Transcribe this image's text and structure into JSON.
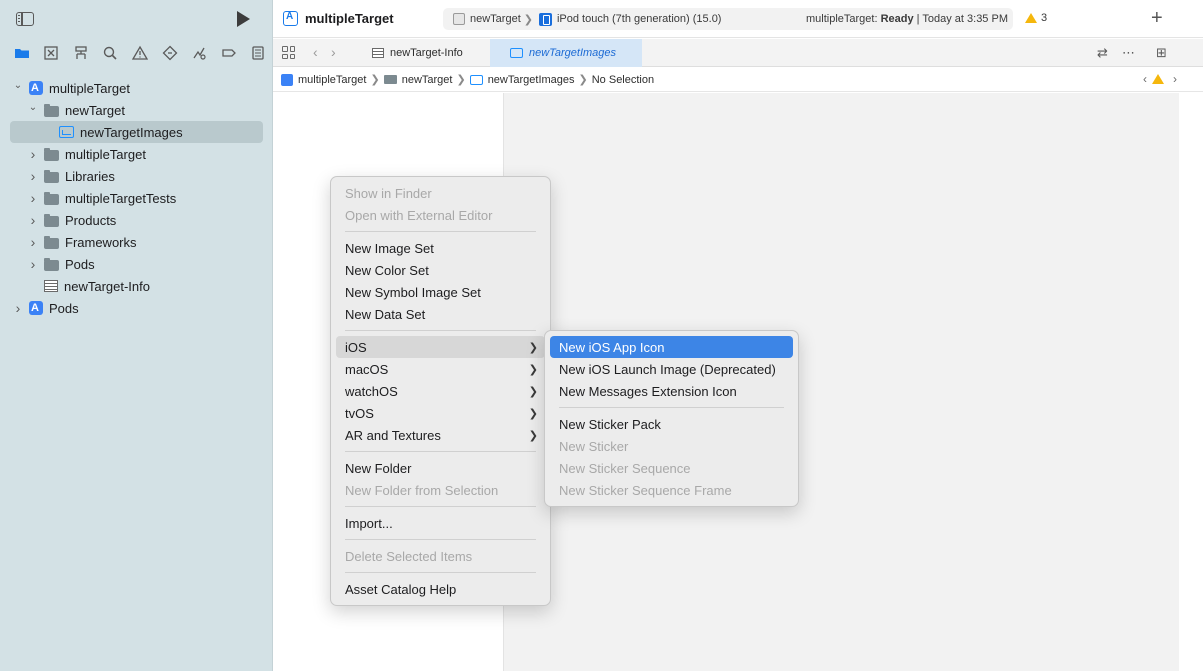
{
  "sidebar": {
    "tree": [
      {
        "label": "multipleTarget",
        "kind": "project",
        "level": 0,
        "expanded": true
      },
      {
        "label": "newTarget",
        "kind": "folder",
        "level": 1,
        "expanded": true
      },
      {
        "label": "newTargetImages",
        "kind": "assets",
        "level": 2,
        "selected": true
      },
      {
        "label": "multipleTarget",
        "kind": "folder",
        "level": 1,
        "expanded": false
      },
      {
        "label": "Libraries",
        "kind": "folder",
        "level": 1,
        "expanded": false
      },
      {
        "label": "multipleTargetTests",
        "kind": "folder",
        "level": 1,
        "expanded": false
      },
      {
        "label": "Products",
        "kind": "folder",
        "level": 1,
        "expanded": false
      },
      {
        "label": "Frameworks",
        "kind": "folder",
        "level": 1,
        "expanded": false
      },
      {
        "label": "Pods",
        "kind": "folder",
        "level": 1,
        "expanded": false
      },
      {
        "label": "newTarget-Info",
        "kind": "plist",
        "level": 1
      },
      {
        "label": "Pods",
        "kind": "project",
        "level": 0,
        "expanded": false
      }
    ],
    "nav_icons": [
      "folder-icon",
      "source-control-icon",
      "symbol-icon",
      "search-icon",
      "issue-icon",
      "test-icon",
      "debug-icon",
      "breakpoint-icon",
      "report-icon"
    ]
  },
  "toolbar": {
    "project_title": "multipleTarget",
    "scheme": "newTarget",
    "device": "iPod touch (7th generation) (15.0)",
    "status_prefix": "multipleTarget: ",
    "status_strong": "Ready",
    "status_suffix": " | Today at 3:35 PM",
    "warning_count": "3",
    "add_label": "+"
  },
  "tabs": [
    {
      "label": "newTarget-Info",
      "active": false
    },
    {
      "label": "newTargetImages",
      "active": true
    }
  ],
  "jumpbar": {
    "crumbs": [
      "multipleTarget",
      "newTarget",
      "newTargetImages"
    ],
    "tail": "No Selection"
  },
  "context_menu": {
    "groups": [
      [
        {
          "label": "Show in Finder",
          "disabled": true
        },
        {
          "label": "Open with External Editor",
          "disabled": true
        }
      ],
      [
        {
          "label": "New Image Set"
        },
        {
          "label": "New Color Set"
        },
        {
          "label": "New Symbol Image Set"
        },
        {
          "label": "New Data Set"
        }
      ],
      [
        {
          "label": "iOS",
          "submenu": true,
          "hover": true
        },
        {
          "label": "macOS",
          "submenu": true
        },
        {
          "label": "watchOS",
          "submenu": true
        },
        {
          "label": "tvOS",
          "submenu": true
        },
        {
          "label": "AR and Textures",
          "submenu": true
        }
      ],
      [
        {
          "label": "New Folder"
        },
        {
          "label": "New Folder from Selection",
          "disabled": true
        }
      ],
      [
        {
          "label": "Import..."
        }
      ],
      [
        {
          "label": "Delete Selected Items",
          "disabled": true
        }
      ],
      [
        {
          "label": "Asset Catalog Help"
        }
      ]
    ]
  },
  "submenu": {
    "groups": [
      [
        {
          "label": "New iOS App Icon",
          "highlight": true
        },
        {
          "label": "New iOS Launch Image (Deprecated)"
        },
        {
          "label": "New Messages Extension Icon"
        }
      ],
      [
        {
          "label": "New Sticker Pack"
        },
        {
          "label": "New Sticker",
          "disabled": true
        },
        {
          "label": "New Sticker Sequence",
          "disabled": true
        },
        {
          "label": "New Sticker Sequence Frame",
          "disabled": true
        }
      ]
    ]
  },
  "colors": {
    "sidebar_bg": "#d3e1e5",
    "accent": "#3d85e6",
    "warning": "#f5b70d"
  }
}
